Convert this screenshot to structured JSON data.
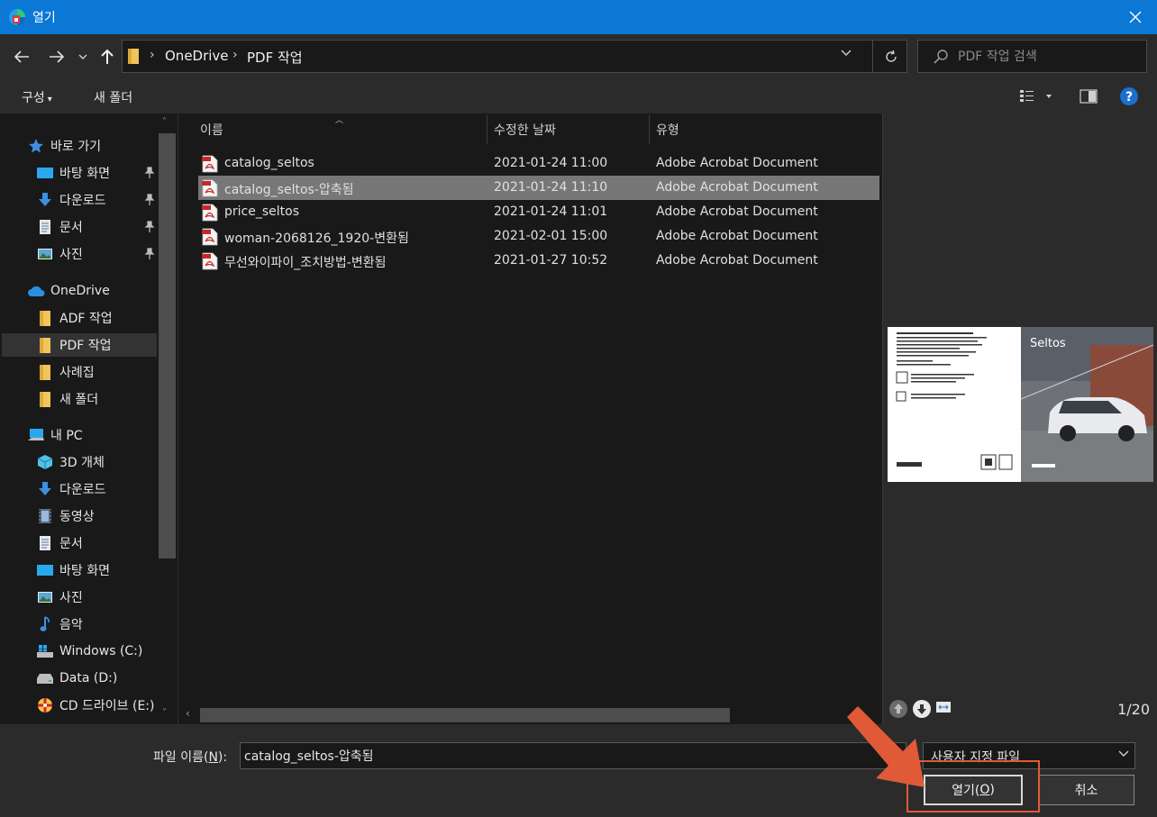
{
  "window": {
    "title": "열기"
  },
  "address": {
    "crumbs": [
      "OneDrive",
      "PDF 작업"
    ]
  },
  "search": {
    "placeholder": "PDF 작업 검색"
  },
  "toolbar": {
    "organize_label": "구성",
    "new_folder_label": "새 폴더"
  },
  "nav": {
    "quick_access": "바로 가기",
    "quick_items": [
      "바탕 화면",
      "다운로드",
      "문서",
      "사진"
    ],
    "onedrive": "OneDrive",
    "onedrive_items": [
      "ADF 작업",
      "PDF 작업",
      "사례집",
      "새 폴더"
    ],
    "this_pc": "내 PC",
    "pc_items": [
      "3D 개체",
      "다운로드",
      "동영상",
      "문서",
      "바탕 화면",
      "사진",
      "음악",
      "Windows (C:)",
      "Data (D:)",
      "CD 드라이브 (E:)"
    ]
  },
  "columns": {
    "name": "이름",
    "date": "수정한 날짜",
    "type": "유형"
  },
  "files": [
    {
      "name": "catalog_seltos",
      "date": "2021-01-24 11:00",
      "type": "Adobe Acrobat Document"
    },
    {
      "name": "catalog_seltos-압축됨",
      "date": "2021-01-24 11:10",
      "type": "Adobe Acrobat Document",
      "selected": true
    },
    {
      "name": "price_seltos",
      "date": "2021-01-24 11:01",
      "type": "Adobe Acrobat Document"
    },
    {
      "name": "woman-2068126_1920-변환됨",
      "date": "2021-02-01 15:00",
      "type": "Adobe Acrobat Document"
    },
    {
      "name": "무선와이파이_조치방법-변환됨",
      "date": "2021-01-27 10:52",
      "type": "Adobe Acrobat Document"
    }
  ],
  "preview": {
    "page_indicator": "1/20",
    "cover_text": "Seltos"
  },
  "footer": {
    "filename_label": "파일 이름(",
    "filename_key": "N",
    "filename_label_end": "):",
    "filename_value": "catalog_seltos-압축됨",
    "filetype_value": "사용자 지정 파일",
    "open_label": "열기(",
    "open_key": "O",
    "open_label_end": ")",
    "cancel_label": "취소"
  },
  "colors": {
    "titlebar": "#0a78d4",
    "selection": "#777777",
    "annotation": "#e05a38"
  }
}
